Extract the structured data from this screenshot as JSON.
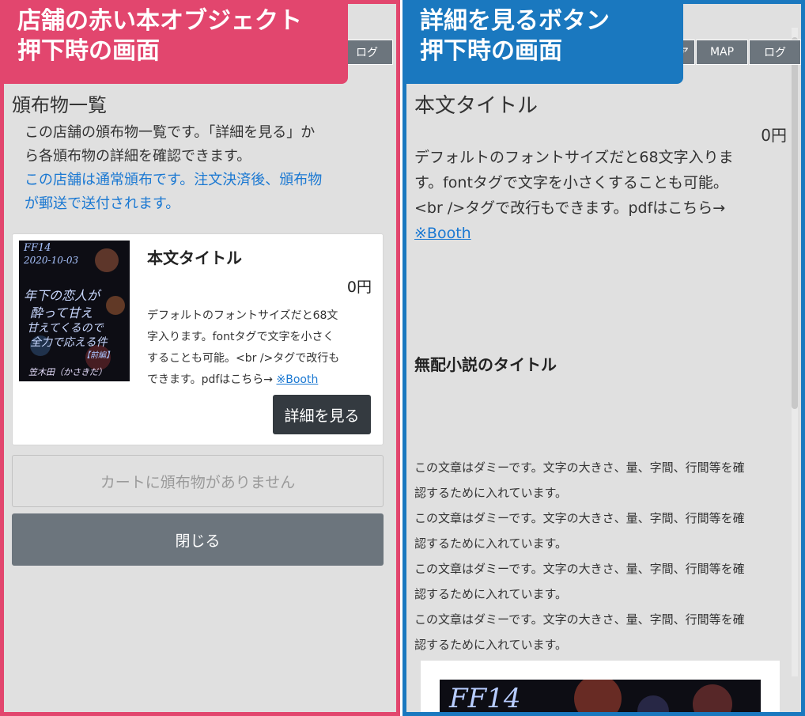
{
  "left": {
    "caption_line1": "店舗の赤い本オブジェクト",
    "caption_line2": "押下時の画面",
    "topbar": {
      "login": "ログ"
    },
    "section_title": "頒布物一覧",
    "description": [
      "この店舗の頒布物一覧です。「詳細を見る」か",
      "ら各頒布物の詳細を確認できます。"
    ],
    "notice": [
      "この店舗は通常頒布です。注文決済後、頒布物",
      "が郵送で送付されます。"
    ],
    "item": {
      "title": "本文タイトル",
      "price": "0円",
      "text_lines": [
        "デフォルトのフォントサイズだと68文",
        "字入ります。fontタグで文字を小さく",
        "することも可能。<br />タグで改行も",
        "できます。pdfはこちら→ "
      ],
      "link": "※Booth",
      "detail_button": "詳細を見る",
      "cover": {
        "line1": "FF14",
        "line2": "2020-10-03",
        "line3": "年下の恋人が",
        "line4": "酔って甘え",
        "line5": "甘えてくるので",
        "line6": "全力で応える件",
        "line7": "【前編】",
        "line8": "笠木田（かさきだ）"
      }
    },
    "cart_empty": "カートに頒布物がありません",
    "close_button": "閉じる"
  },
  "right": {
    "caption_line1": "詳細を見るボタン",
    "caption_line2": "押下時の画面",
    "topbar": {
      "item1": "ア",
      "map": "MAP",
      "login": "ログ"
    },
    "title": "本文タイトル",
    "price": "0円",
    "desc_lines": [
      "デフォルトのフォントサイズだと68文字入りま",
      "す。fontタグで文字を小さくすることも可能。",
      "<br />タグで改行もできます。pdfはこちら→"
    ],
    "link": "※Booth",
    "novel_title": "無配小説のタイトル",
    "dummy_lines": [
      "この文章はダミーです。文字の大きさ、量、字間、行間等を確",
      "認するために入れています。",
      "この文章はダミーです。文字の大きさ、量、字間、行間等を確",
      "認するために入れています。",
      "この文章はダミーです。文字の大きさ、量、字間、行間等を確",
      "認するために入れています。",
      "この文章はダミーです。文字の大きさ、量、字間、行間等を確",
      "認するために入れています。"
    ],
    "cover_text": "FF14"
  },
  "colors": {
    "left_accent": "#e2466e",
    "right_accent": "#1a78bf",
    "link": "#1a78d2",
    "dark_button": "#343a40",
    "gray_button": "#6c757d"
  }
}
